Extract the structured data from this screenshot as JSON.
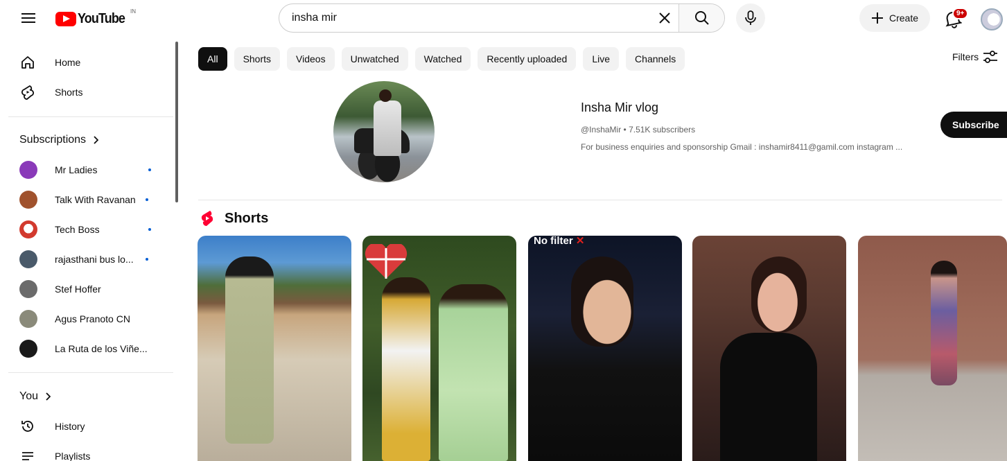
{
  "header": {
    "logo_text": "YouTube",
    "logo_country": "IN",
    "search_value": "insha mir",
    "search_placeholder": "Search",
    "create_label": "Create",
    "notification_count": "9+"
  },
  "sidebar": {
    "nav": [
      {
        "label": "Home",
        "icon": "home-icon"
      },
      {
        "label": "Shorts",
        "icon": "shorts-icon"
      }
    ],
    "subscriptions_title": "Subscriptions",
    "subscriptions": [
      {
        "label": "Mr Ladies",
        "color": "#8a3ab9",
        "new": true
      },
      {
        "label": "Talk With Ravanan",
        "color": "#a0522d",
        "new": true
      },
      {
        "label": "Tech Boss",
        "color": "#d23a2e",
        "new": true
      },
      {
        "label": "rajasthani bus lo...",
        "color": "#4a5a6a",
        "new": true
      },
      {
        "label": "Stef Hoffer",
        "color": "#6b6b6b",
        "new": false
      },
      {
        "label": "Agus Pranoto CN",
        "color": "#8a8a7a",
        "new": false
      },
      {
        "label": "La Ruta de los Viñe...",
        "color": "#1a1a1a",
        "new": false
      }
    ],
    "you_title": "You",
    "you_items": [
      {
        "label": "History",
        "icon": "history-icon"
      },
      {
        "label": "Playlists",
        "icon": "playlists-icon"
      }
    ]
  },
  "chips": [
    "All",
    "Shorts",
    "Videos",
    "Unwatched",
    "Watched",
    "Recently uploaded",
    "Live",
    "Channels"
  ],
  "active_chip": "All",
  "filters_label": "Filters",
  "channel": {
    "name": "Insha Mir vlog",
    "meta": "@InshaMir • 7.51K subscribers",
    "description": "For business enquiries and sponsorship Gmail : inshamir8411@gamil.com instagram ...",
    "subscribe_label": "Subscribe"
  },
  "shorts_section": {
    "title": "Shorts",
    "items": [
      {
        "overlay": ""
      },
      {
        "overlay": ""
      },
      {
        "overlay": "No filter"
      },
      {
        "overlay": ""
      },
      {
        "overlay": ""
      }
    ]
  },
  "colors": {
    "brand_red": "#ff0000",
    "text_primary": "#0f0f0f",
    "text_secondary": "#606060",
    "chip_bg": "#f2f2f2",
    "subscribe_bg": "#0f0f0f"
  }
}
